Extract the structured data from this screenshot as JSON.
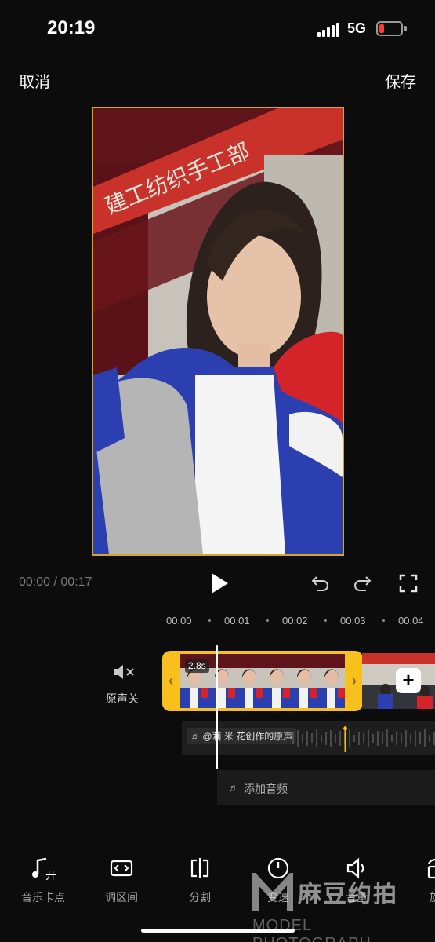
{
  "status_bar": {
    "time": "20:19",
    "network": "5G",
    "battery_color": "#ff3b30"
  },
  "nav": {
    "cancel": "取消",
    "save": "保存"
  },
  "preview": {
    "banner_text": "建工纺织手工部"
  },
  "playback": {
    "current_time": "00:00",
    "separator": "/",
    "total_time": "00:17"
  },
  "ruler": {
    "ticks": [
      "00:00",
      "00:01",
      "00:02",
      "00:03",
      "00:04"
    ]
  },
  "track": {
    "mute_label": "原声关",
    "clip_duration": "2.8s",
    "audio_label": "@莉 米 花创作的原声",
    "add_audio_label": "添加音频"
  },
  "colors": {
    "accent": "#f7c01c",
    "background": "#0c0c0c"
  },
  "toolbar": {
    "items": [
      {
        "label": "音乐卡点",
        "icon": "music-beat-icon"
      },
      {
        "label": "调区间",
        "icon": "range-icon"
      },
      {
        "label": "分割",
        "icon": "split-icon"
      },
      {
        "label": "变速",
        "icon": "speed-icon"
      },
      {
        "label": "音量",
        "icon": "volume-icon"
      },
      {
        "label": "旋",
        "icon": "rotate-icon"
      }
    ]
  },
  "watermark": {
    "title": "麻豆约拍",
    "subtitle": "MODEL PHOTOGRAPH"
  }
}
